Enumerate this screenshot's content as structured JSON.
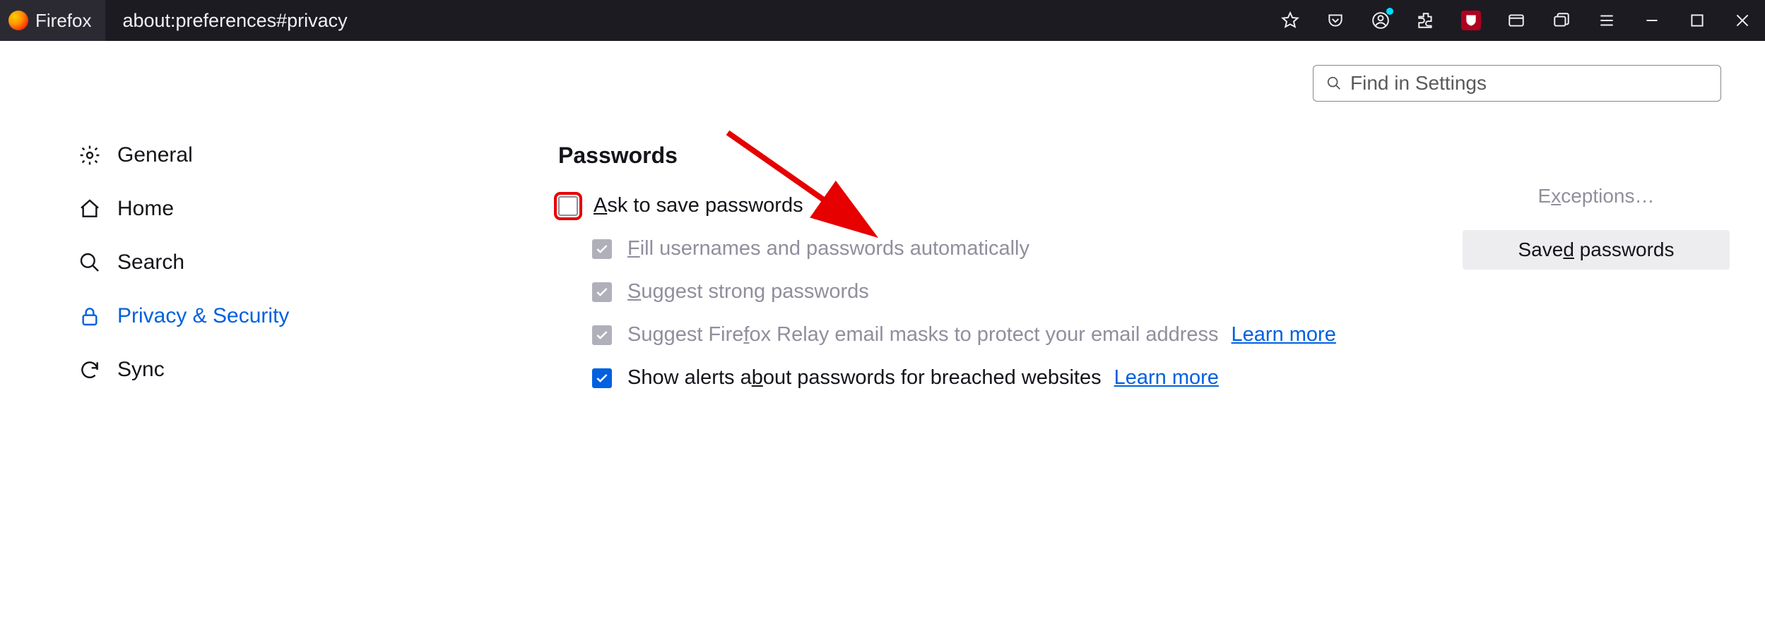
{
  "titlebar": {
    "app_name": "Firefox",
    "url": "about:preferences#privacy"
  },
  "settings_search": {
    "placeholder": "Find in Settings"
  },
  "sidebar": {
    "items": [
      {
        "label": "General"
      },
      {
        "label": "Home"
      },
      {
        "label": "Search"
      },
      {
        "label": "Privacy & Security"
      },
      {
        "label": "Sync"
      }
    ]
  },
  "main": {
    "section_heading": "Passwords",
    "options": {
      "ask_save": {
        "pre": "A",
        "rest": "sk to save passwords"
      },
      "fill_auto": {
        "pre": "F",
        "rest": "ill usernames and passwords automatically"
      },
      "suggest_strong": {
        "pre": "S",
        "rest": "uggest strong passwords"
      },
      "suggest_relay": {
        "pre1": "Suggest Fire",
        "ul": "f",
        "post": "ox Relay email masks to protect your email address"
      },
      "breach_alerts": {
        "pre1": "Show alerts a",
        "ul": "b",
        "post": "out passwords for breached websites"
      }
    },
    "learn_more": "Learn more",
    "side_buttons": {
      "exceptions": {
        "pre": "E",
        "ul": "x",
        "post": "ceptions…"
      },
      "saved": {
        "pre": "Save",
        "ul": "d",
        "post": " passwords"
      }
    }
  }
}
